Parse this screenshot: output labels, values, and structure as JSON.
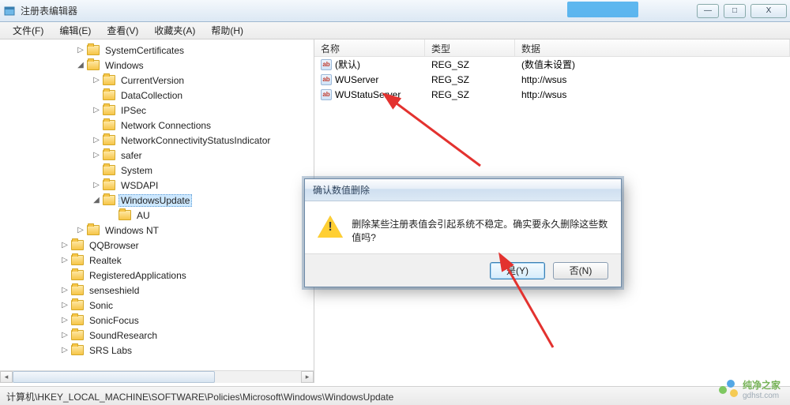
{
  "window": {
    "title": "注册表编辑器",
    "minimize": "—",
    "maximize": "□",
    "close": "X"
  },
  "menu": {
    "file": "文件(F)",
    "edit": "编辑(E)",
    "view": "查看(V)",
    "favorites": "收藏夹(A)",
    "help": "帮助(H)"
  },
  "tree": {
    "items": [
      {
        "indent": 96,
        "label": "SystemCertificates",
        "exp": "▷"
      },
      {
        "indent": 96,
        "label": "Windows",
        "exp": "◢"
      },
      {
        "indent": 116,
        "label": "CurrentVersion",
        "exp": "▷"
      },
      {
        "indent": 116,
        "label": "DataCollection",
        "exp": ""
      },
      {
        "indent": 116,
        "label": "IPSec",
        "exp": "▷"
      },
      {
        "indent": 116,
        "label": "Network Connections",
        "exp": ""
      },
      {
        "indent": 116,
        "label": "NetworkConnectivityStatusIndicator",
        "exp": "▷"
      },
      {
        "indent": 116,
        "label": "safer",
        "exp": "▷"
      },
      {
        "indent": 116,
        "label": "System",
        "exp": ""
      },
      {
        "indent": 116,
        "label": "WSDAPI",
        "exp": "▷"
      },
      {
        "indent": 116,
        "label": "WindowsUpdate",
        "exp": "◢",
        "selected": true
      },
      {
        "indent": 136,
        "label": "AU",
        "exp": ""
      },
      {
        "indent": 96,
        "label": "Windows NT",
        "exp": "▷"
      },
      {
        "indent": 76,
        "label": "QQBrowser",
        "exp": "▷"
      },
      {
        "indent": 76,
        "label": "Realtek",
        "exp": "▷"
      },
      {
        "indent": 76,
        "label": "RegisteredApplications",
        "exp": ""
      },
      {
        "indent": 76,
        "label": "senseshield",
        "exp": "▷"
      },
      {
        "indent": 76,
        "label": "Sonic",
        "exp": "▷"
      },
      {
        "indent": 76,
        "label": "SonicFocus",
        "exp": "▷"
      },
      {
        "indent": 76,
        "label": "SoundResearch",
        "exp": "▷"
      },
      {
        "indent": 76,
        "label": "SRS Labs",
        "exp": "▷"
      }
    ]
  },
  "list": {
    "headers": {
      "name": "名称",
      "type": "类型",
      "data": "数据"
    },
    "rows": [
      {
        "name": "(默认)",
        "type": "REG_SZ",
        "data": "(数值未设置)"
      },
      {
        "name": "WUServer",
        "type": "REG_SZ",
        "data": "http://wsus"
      },
      {
        "name": "WUStatuServer",
        "type": "REG_SZ",
        "data": "http://wsus"
      }
    ]
  },
  "dialog": {
    "title": "确认数值删除",
    "message": "删除某些注册表值会引起系统不稳定。确实要永久删除这些数值吗?",
    "yes": "是(Y)",
    "no": "否(N)"
  },
  "statusbar": {
    "path": "计算机\\HKEY_LOCAL_MACHINE\\SOFTWARE\\Policies\\Microsoft\\Windows\\WindowsUpdate"
  },
  "watermark": {
    "brand": "纯净之家",
    "url": "gdhst.com"
  }
}
